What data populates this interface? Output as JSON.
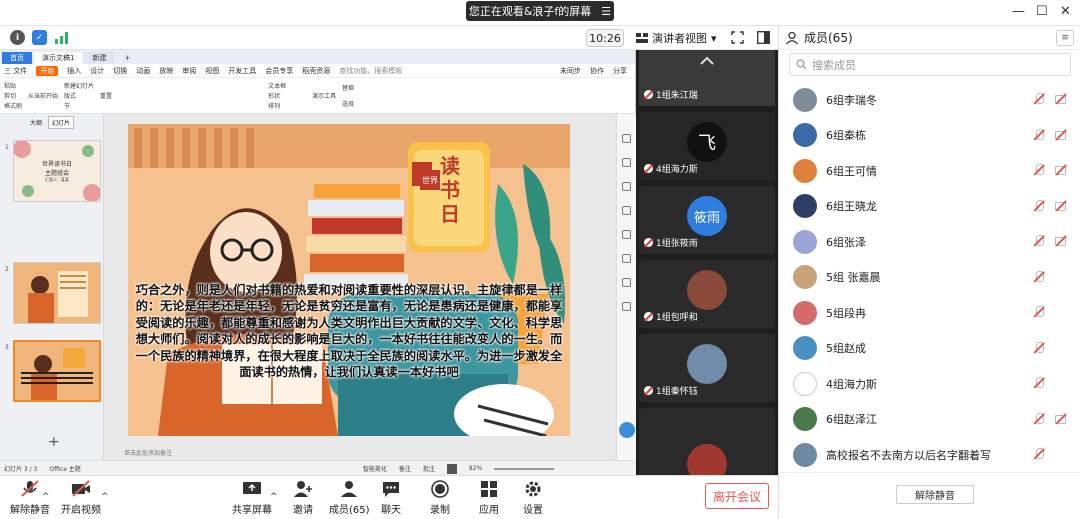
{
  "window": {
    "share_banner": "您正在观看&浪子f的屏幕",
    "banner_menu": "☰",
    "minimize": "—",
    "maximize": "☐",
    "close": "✕"
  },
  "meeting_bar": {
    "timer": "10:26",
    "view_mode": "演讲者视图",
    "view_caret": "▾"
  },
  "wps": {
    "tabs": [
      "首页",
      "演示文稿1",
      "新建"
    ],
    "add_tab": "+",
    "file_menu": "三 文件",
    "menus": [
      "开始",
      "插入",
      "设计",
      "切换",
      "动画",
      "放映",
      "审阅",
      "视图",
      "开发工具",
      "会员专享",
      "稻壳资源"
    ],
    "active_menu": "开始",
    "search_hint": "查找功能、搜索模板",
    "right_actions": [
      "未同步",
      "协作",
      "分享"
    ],
    "ribbon_groups": [
      [
        "粘贴",
        "剪切",
        "格式刷"
      ],
      [
        "从当前开始"
      ],
      [
        "新建幻灯片",
        "版式",
        "节"
      ],
      [
        "重置"
      ],
      [
        "文本框",
        "形状",
        "排列"
      ],
      [
        "演示工具"
      ],
      [
        "替换",
        "选择"
      ]
    ],
    "thumb_tabs": [
      "大纲",
      "幻灯片"
    ],
    "thumbs": [
      {
        "num": "1",
        "title": "世界读书日",
        "subtitle": "主题班会",
        "caption": "汇报人：某某"
      },
      {
        "num": "2"
      },
      {
        "num": "3"
      }
    ],
    "add_slide": "+",
    "slide_text": "巧合之外，则是人们对书籍的热爱和对阅读重要性的深层认识。主旋律都是一样的：无论是年老还是年轻，无论是贫穷还是富有，无论是患病还是健康，都能享受阅读的乐趣，都能尊重和感谢为人类文明作出巨大贡献的文学、文化、科学思想大师们。阅读对人的成长的影响是巨大的，一本好书往往能改变人的一生。而一个民族的精神境界，在很大程度上取决于全民族的阅读水平。为进一步激发全面读书的热情，让我们认真读一本好书吧",
    "slide_badge": "世界",
    "slide_heading": "读书日",
    "notes_hint": "单击此处添加备注",
    "status_left": "幻灯片 3 / 3",
    "status_theme": "Office 主题",
    "status_smart": "智能美化",
    "status_notes": "备注",
    "status_comment": "批注",
    "zoom": "82%"
  },
  "video_tiles": [
    {
      "name": "1组朱江瑞"
    },
    {
      "name": "4组海力斯",
      "avatar_text": "飞"
    },
    {
      "name": "1组张筱雨",
      "avatar_text": "筱雨"
    },
    {
      "name": "1组包呼和"
    },
    {
      "name": "1组秦怀钰"
    },
    {
      "name": ""
    }
  ],
  "members_panel": {
    "title": "成员(65)",
    "menu": "≡",
    "search_placeholder": "搜索成员",
    "members": [
      {
        "name": "6组李瑞冬",
        "avatar_color": "#7f8c99",
        "cam": true
      },
      {
        "name": "6组秦栋",
        "avatar_color": "#3b6aa8",
        "cam": true
      },
      {
        "name": "6组王可情",
        "avatar_color": "#e0803a",
        "cam": true
      },
      {
        "name": "6组王晓龙",
        "avatar_color": "#2d3e67",
        "cam": true
      },
      {
        "name": "6组张泽",
        "avatar_color": "#9aa4d6",
        "cam": true
      },
      {
        "name": "5组 张嘉晨",
        "avatar_color": "#c9a27a",
        "cam": false
      },
      {
        "name": "5组段冉",
        "avatar_color": "#d46b6b",
        "cam": false
      },
      {
        "name": "5组赵成",
        "avatar_color": "#4a8fc4",
        "cam": false
      },
      {
        "name": "4组海力斯",
        "avatar_color": "#ffffff",
        "cam": false
      },
      {
        "name": "6组赵泽江",
        "avatar_color": "#4a7a4a",
        "cam": true
      },
      {
        "name": "高校报名不去南方以后名字翻着写",
        "avatar_color": "#6c8aa3",
        "cam": false
      }
    ],
    "unmute_all": "解除静音"
  },
  "controls": {
    "unmute": "解除静音",
    "start_video": "开启视频",
    "share_screen": "共享屏幕",
    "invite": "邀请",
    "members": "成员(65)",
    "chat": "聊天",
    "record": "录制",
    "apps": "应用",
    "settings": "设置",
    "leave": "离开会议",
    "caret": "^"
  },
  "colors": {
    "accent_blue": "#2f7de1",
    "wps_orange": "#ff6a00",
    "leave_red": "#e35a4f",
    "muted_red": "#e05757"
  }
}
